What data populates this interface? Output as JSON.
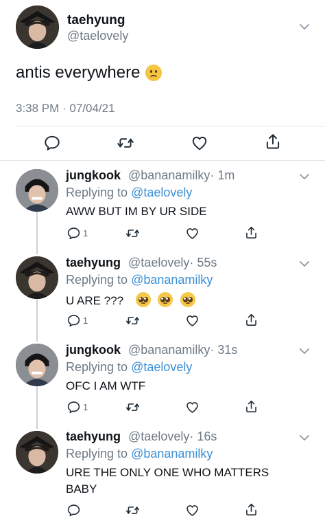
{
  "main_tweet": {
    "display_name": "taehyung",
    "handle": "@taelovely",
    "text": "antis everywhere",
    "emoji": "frowning-face",
    "meta": "3:38 PM · 07/04/21"
  },
  "colors": {
    "link": "#3a8fd8",
    "muted": "#6e7a85",
    "icon": "#1f2a33",
    "divider": "#e1e6ea"
  },
  "replies": [
    {
      "display_name": "jungkook",
      "handle": "@bananamilky",
      "time": "· 1m",
      "replying_prefix": "Replying to",
      "replying_handle": "@taelovely",
      "text": "AWW BUT IM BY UR SIDE",
      "reply_count": "1"
    },
    {
      "display_name": "taehyung",
      "handle": "@taelovely",
      "time": "· 55s",
      "replying_prefix": "Replying to",
      "replying_handle": "@bananamilky",
      "text": "U ARE ???",
      "emojis": [
        "pleading-face",
        "pleading-face",
        "pleading-face"
      ],
      "reply_count": "1"
    },
    {
      "display_name": "jungkook",
      "handle": "@bananamilky",
      "time": "· 31s",
      "replying_prefix": "Replying to",
      "replying_handle": "@taelovely",
      "text": "OFC I AM WTF",
      "reply_count": "1"
    },
    {
      "display_name": "taehyung",
      "handle": "@taelovely",
      "time": "· 16s",
      "replying_prefix": "Replying to",
      "replying_handle": "@bananamilky",
      "text_line1": "URE THE ONLY ONE WHO MATTERS",
      "text_line2": "BABY",
      "reply_count": ""
    }
  ],
  "icons": [
    "chevron-down-icon",
    "reply-icon",
    "retweet-icon",
    "like-icon",
    "share-icon"
  ]
}
